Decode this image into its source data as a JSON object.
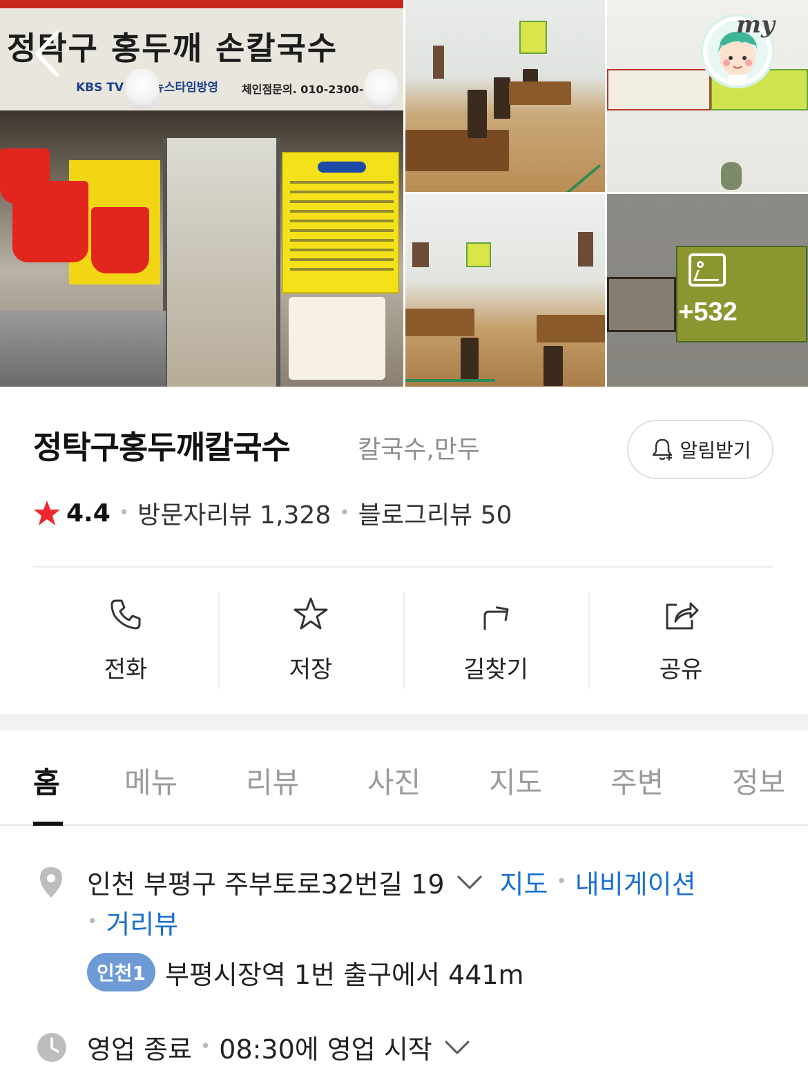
{
  "gallery": {
    "main_sign_text": "정탁구 홍두깨 손칼국수",
    "main_sign_sub": "KBS TV 아침 뉴스타임방영",
    "main_sign_phone": "체인점문의. 010-2300-",
    "more_photos_label": "+532"
  },
  "avatar": {
    "label": "my"
  },
  "place": {
    "name": "정탁구홍두깨칼국수",
    "category": "칼국수,만두",
    "notify_label": "알림받기",
    "rating": "4.4",
    "visitor_reviews": "방문자리뷰 1,328",
    "blog_reviews": "블로그리뷰 50"
  },
  "actions": [
    {
      "label": "전화",
      "icon": "phone-icon"
    },
    {
      "label": "저장",
      "icon": "star-icon"
    },
    {
      "label": "길찾기",
      "icon": "directions-icon"
    },
    {
      "label": "공유",
      "icon": "share-icon"
    }
  ],
  "tabs": [
    {
      "label": "홈",
      "active": true
    },
    {
      "label": "메뉴"
    },
    {
      "label": "리뷰"
    },
    {
      "label": "사진"
    },
    {
      "label": "지도"
    },
    {
      "label": "주변"
    },
    {
      "label": "정보"
    }
  ],
  "info": {
    "address": "인천 부평구 주부토로32번길 19",
    "map_link": "지도",
    "navigation_link": "내비게이션",
    "streetview_link": "거리뷰",
    "subway_line": "인천1",
    "subway_text": "부평시장역 1번 출구에서 441m",
    "hours_status": "영업 종료",
    "hours_text": "08:30에 영업 시작"
  },
  "colors": {
    "accent_blue": "#1a6fd1",
    "star_red": "#f0282d",
    "subway_badge": "#6e9ad6",
    "muted": "#9b9b9b"
  }
}
